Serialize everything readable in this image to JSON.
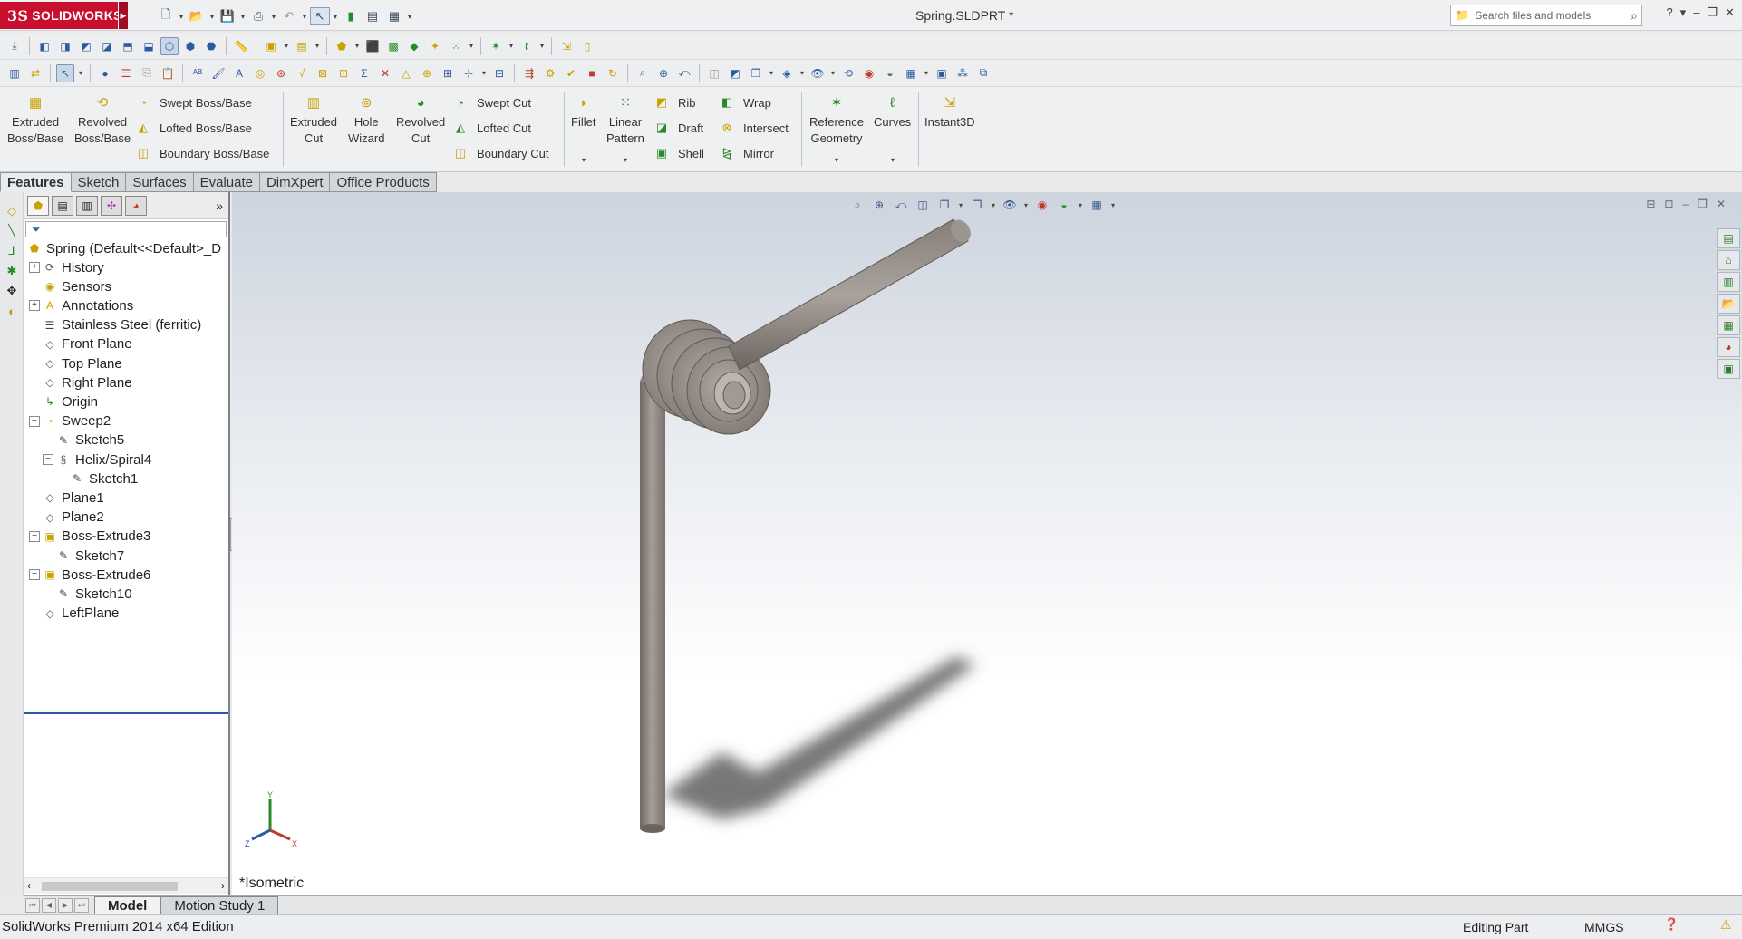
{
  "app": {
    "logo_text": "SOLIDWORKS",
    "logo_mark": "3S",
    "document_title": "Spring.SLDPRT *",
    "search_placeholder": "Search files and models"
  },
  "command_manager": {
    "extruded_boss": "Extruded\nBoss/Base",
    "revolved_boss": "Revolved\nBoss/Base",
    "swept_boss": "Swept Boss/Base",
    "lofted_boss": "Lofted Boss/Base",
    "boundary_boss": "Boundary Boss/Base",
    "extruded_cut": "Extruded\nCut",
    "hole_wizard": "Hole\nWizard",
    "revolved_cut": "Revolved\nCut",
    "swept_cut": "Swept Cut",
    "lofted_cut": "Lofted Cut",
    "boundary_cut": "Boundary Cut",
    "fillet": "Fillet",
    "linear_pattern": "Linear\nPattern",
    "rib": "Rib",
    "draft": "Draft",
    "shell": "Shell",
    "wrap": "Wrap",
    "intersect": "Intersect",
    "mirror": "Mirror",
    "reference_geometry": "Reference\nGeometry",
    "curves": "Curves",
    "instant3d": "Instant3D"
  },
  "tabs": [
    "Features",
    "Sketch",
    "Surfaces",
    "Evaluate",
    "DimXpert",
    "Office Products"
  ],
  "feature_tree": {
    "root": "Spring  (Default<<Default>_D",
    "items": [
      {
        "label": "History",
        "icon": "history-icon",
        "expand": "+"
      },
      {
        "label": "Sensors",
        "icon": "sensors-icon",
        "expand": ""
      },
      {
        "label": "Annotations",
        "icon": "annotations-icon",
        "expand": "+"
      },
      {
        "label": "Stainless Steel (ferritic)",
        "icon": "material-icon",
        "expand": ""
      },
      {
        "label": "Front Plane",
        "icon": "plane-icon",
        "expand": ""
      },
      {
        "label": "Top Plane",
        "icon": "plane-icon",
        "expand": ""
      },
      {
        "label": "Right Plane",
        "icon": "plane-icon",
        "expand": ""
      },
      {
        "label": "Origin",
        "icon": "origin-icon",
        "expand": ""
      },
      {
        "label": "Sweep2",
        "icon": "sweep-icon",
        "expand": "−"
      },
      {
        "label": "Sketch5",
        "icon": "sketch-icon",
        "expand": ""
      },
      {
        "label": "Helix/Spiral4",
        "icon": "helix-icon",
        "expand": "−"
      },
      {
        "label": "Sketch1",
        "icon": "sketch-icon",
        "expand": ""
      },
      {
        "label": "Plane1",
        "icon": "plane-icon",
        "expand": ""
      },
      {
        "label": "Plane2",
        "icon": "plane-icon",
        "expand": ""
      },
      {
        "label": "Boss-Extrude3",
        "icon": "extrude-icon",
        "expand": "−"
      },
      {
        "label": "Sketch7",
        "icon": "sketch-icon",
        "expand": ""
      },
      {
        "label": "Boss-Extrude6",
        "icon": "extrude-icon",
        "expand": "−"
      },
      {
        "label": "Sketch10",
        "icon": "sketch-icon",
        "expand": ""
      },
      {
        "label": "LeftPlane",
        "icon": "plane-icon",
        "expand": ""
      }
    ]
  },
  "viewport": {
    "view_name": "*Isometric",
    "triad": {
      "x": "X",
      "y": "Y",
      "z": "Z"
    }
  },
  "bottom_tabs": [
    "Model",
    "Motion Study 1"
  ],
  "status": {
    "edition": "SolidWorks Premium 2014 x64 Edition",
    "mode": "Editing Part",
    "units": "MMGS"
  },
  "colors": {
    "brand": "#c8102e",
    "model_fill": "#8f8882",
    "selection": "#2c5aa0"
  }
}
